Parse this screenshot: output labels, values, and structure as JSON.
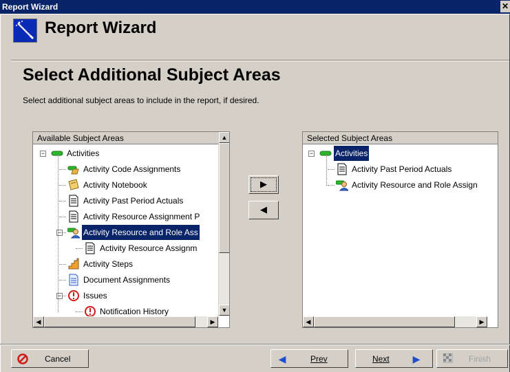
{
  "window": {
    "title": "Report Wizard",
    "close_glyph": "✕"
  },
  "header": {
    "title": "Report Wizard",
    "icon": "magic-wand-icon"
  },
  "page": {
    "title": "Select Additional Subject Areas",
    "description": "Select additional subject areas to include in the report, if desired."
  },
  "available": {
    "header": "Available Subject Areas",
    "items": [
      {
        "label": "Activities",
        "icon": "activity-bar-icon",
        "level": 0,
        "expander": "−"
      },
      {
        "label": "Activity Code Assignments",
        "icon": "code-assignment-icon",
        "level": 1
      },
      {
        "label": "Activity Notebook",
        "icon": "notebook-icon",
        "level": 1
      },
      {
        "label": "Activity Past Period Actuals",
        "icon": "document-icon",
        "level": 1
      },
      {
        "label": "Activity Resource Assignment P",
        "icon": "document-icon",
        "level": 1
      },
      {
        "label": "Activity Resource and Role Ass",
        "icon": "resource-role-icon",
        "level": 1,
        "expander": "−",
        "selected": true
      },
      {
        "label": "Activity Resource Assignm",
        "icon": "document-icon",
        "level": 2
      },
      {
        "label": "Activity Steps",
        "icon": "steps-icon",
        "level": 1
      },
      {
        "label": "Document Assignments",
        "icon": "document-blue-icon",
        "level": 1
      },
      {
        "label": "Issues",
        "icon": "issue-icon",
        "level": 1,
        "expander": "−"
      },
      {
        "label": "Notification History",
        "icon": "issue-icon",
        "level": 2
      }
    ]
  },
  "selected": {
    "header": "Selected Subject Areas",
    "items": [
      {
        "label": "Activities",
        "icon": "activity-bar-icon",
        "level": 0,
        "expander": "−",
        "selected": true
      },
      {
        "label": "Activity Past Period Actuals",
        "icon": "document-icon",
        "level": 1
      },
      {
        "label": "Activity Resource and Role Assign",
        "icon": "resource-role-icon",
        "level": 1
      }
    ]
  },
  "move": {
    "add_glyph": "▶",
    "remove_glyph": "◀"
  },
  "footer": {
    "cancel_label": "Cancel",
    "prev_label": "Prev",
    "next_label": "Next",
    "finish_label": "Finish"
  },
  "colors": {
    "titlebar": "#0a246a",
    "selection": "#0a246a",
    "dialog_bg": "#d4d0c8",
    "nav_arrow": "#1f4fd1",
    "cancel_red": "#d11a1a"
  }
}
